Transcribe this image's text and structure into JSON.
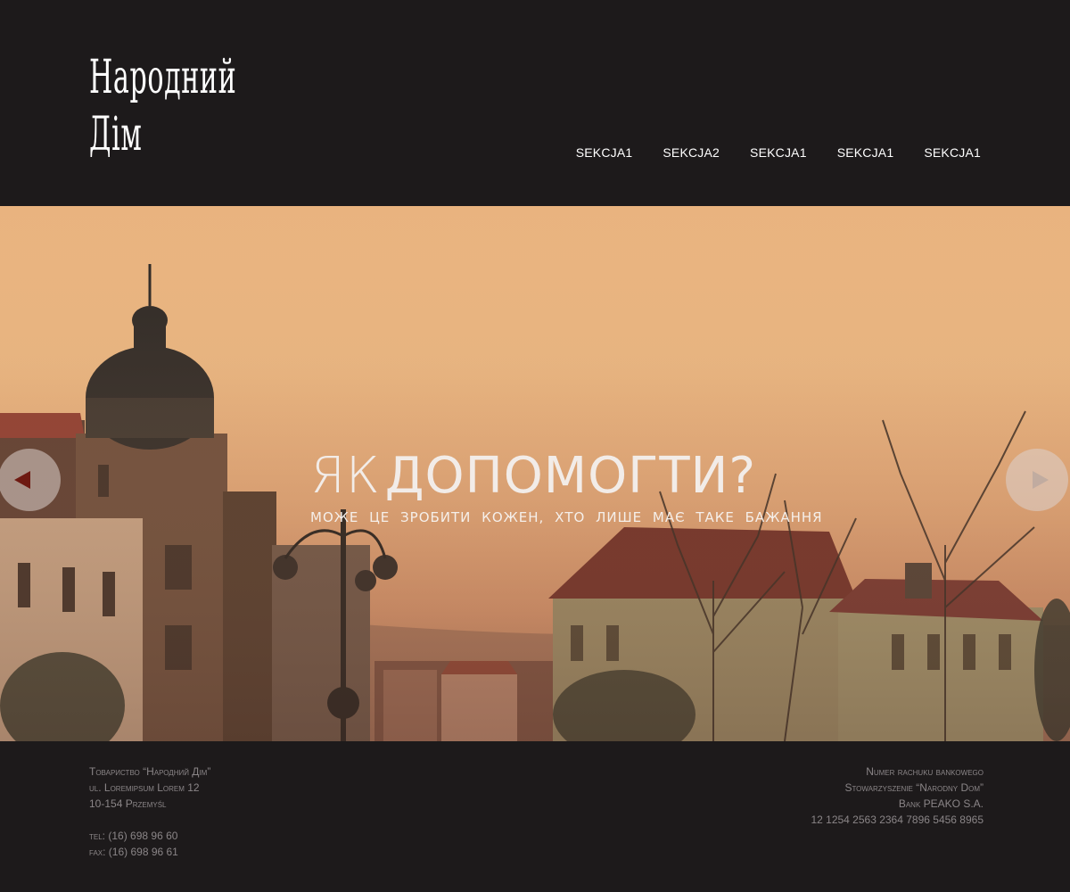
{
  "header": {
    "logo_line1": "Народний",
    "logo_line2": "Дім",
    "nav": [
      {
        "label": "SEKCJA1"
      },
      {
        "label": "SEKCJA2"
      },
      {
        "label": "SEKCJA1"
      },
      {
        "label": "SEKCJA1"
      },
      {
        "label": "SEKCJA1"
      }
    ]
  },
  "hero": {
    "title_part1": "ЯК",
    "title_part2": "ДОПОМОГТИ?",
    "subtitle": "МОЖЕ ЦЕ ЗРОБИТИ КОЖЕН, ХТО ЛИШЕ МАЄ ТАКЕ БАЖАННЯ",
    "prev_icon": "arrow-left-icon",
    "next_icon": "arrow-right-icon"
  },
  "footer": {
    "left": {
      "org": "Товариство “Народний Дім”",
      "street": "ul. Loremipsum Lorem 12",
      "city": "10-154 Przemyśl",
      "tel_label": "tel:",
      "tel": "(16) 698 96 60",
      "fax_label": "fax:",
      "fax": "(16) 698 96 61"
    },
    "right": {
      "heading": "Numer rachuku bankowego",
      "org": "Stowarzyszenie “Narodny Dom”",
      "bank": "Bank PEAKO S.A.",
      "account": "12 1254 2563 2364 7896 5456 8965"
    }
  },
  "colors": {
    "background": "#1d1a1b",
    "text": "#ffffff",
    "footer_text": "#8a8587"
  }
}
